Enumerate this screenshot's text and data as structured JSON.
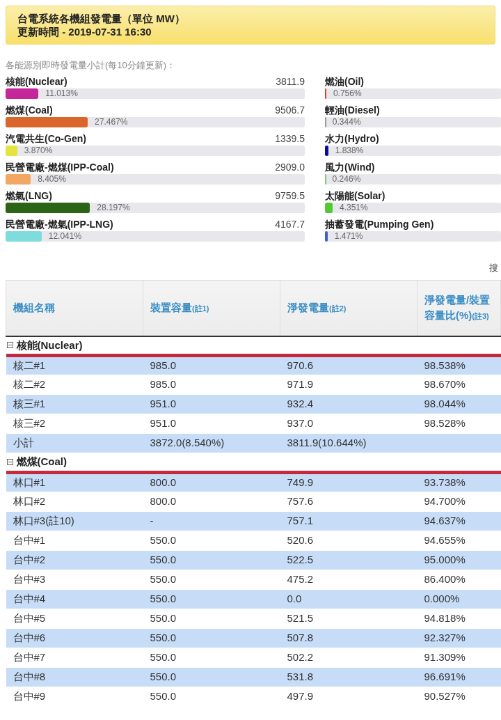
{
  "header": {
    "title": "台電系統各機組發電量（單位 MW）",
    "updated": "更新時間 - 2019-07-31 16:30"
  },
  "summary": {
    "caption": "各能源別即時發電量小計(每10分鐘更新)：",
    "left": [
      {
        "name": "核能(Nuclear)",
        "value": "3811.9",
        "percent": "11.013%",
        "level": 0.11013,
        "color": "#c4279a"
      },
      {
        "name": "燃煤(Coal)",
        "value": "9506.7",
        "percent": "27.467%",
        "level": 0.27467,
        "color": "#d9662b"
      },
      {
        "name": "汽電共生(Co-Gen)",
        "value": "1339.5",
        "percent": "3.870%",
        "level": 0.0387,
        "color": "#e6e340"
      },
      {
        "name": "民營電廠-燃煤(IPP-Coal)",
        "value": "2909.0",
        "percent": "8.405%",
        "level": 0.08405,
        "color": "#f2a863"
      },
      {
        "name": "燃氣(LNG)",
        "value": "9759.5",
        "percent": "28.197%",
        "level": 0.28197,
        "color": "#2a6414"
      },
      {
        "name": "民營電廠-燃氣(IPP-LNG)",
        "value": "4167.7",
        "percent": "12.041%",
        "level": 0.12041,
        "color": "#7fdcdc"
      }
    ],
    "right": [
      {
        "name": "燃油(Oil)",
        "percent": "0.756%",
        "level": 0.00756,
        "color": "#e0442c"
      },
      {
        "name": "輕油(Diesel)",
        "percent": "0.344%",
        "level": 0.00344,
        "color": "#9a9a9a"
      },
      {
        "name": "水力(Hydro)",
        "percent": "1.838%",
        "level": 0.01838,
        "color": "#0a0aa0"
      },
      {
        "name": "風力(Wind)",
        "percent": "0.246%",
        "level": 0.00246,
        "color": "#7fc77f"
      },
      {
        "name": "太陽能(Solar)",
        "percent": "4.351%",
        "level": 0.04351,
        "color": "#52c934"
      },
      {
        "name": "抽蓄發電(Pumping Gen)",
        "percent": "1.471%",
        "level": 0.01471,
        "color": "#3d63c9"
      }
    ]
  },
  "search_label": "搜",
  "table": {
    "columns": [
      {
        "label": "機組名稱"
      },
      {
        "label": "裝置容量",
        "note": "(註1)"
      },
      {
        "label": "淨發電量",
        "note": "(註2)"
      },
      {
        "label": "淨發電量/裝置容量比(%)",
        "note": "(註3)"
      }
    ],
    "groups": [
      {
        "name": "核能(Nuclear)",
        "expanded": true,
        "rows": [
          {
            "kind": "unit",
            "cells": [
              "核二#1",
              "985.0",
              "970.6",
              "98.538%"
            ]
          },
          {
            "kind": "unit",
            "cells": [
              "核二#2",
              "985.0",
              "971.9",
              "98.670%"
            ]
          },
          {
            "kind": "unit",
            "cells": [
              "核三#1",
              "951.0",
              "932.4",
              "98.044%"
            ]
          },
          {
            "kind": "unit",
            "cells": [
              "核三#2",
              "951.0",
              "937.0",
              "98.528%"
            ]
          },
          {
            "kind": "subtotal",
            "cells": [
              "小計",
              "3872.0(8.540%)",
              "3811.9(10.644%)"
            ]
          }
        ]
      },
      {
        "name": "燃煤(Coal)",
        "expanded": true,
        "rows": [
          {
            "kind": "unit",
            "cells": [
              "林口#1",
              "800.0",
              "749.9",
              "93.738%"
            ]
          },
          {
            "kind": "unit",
            "cells": [
              "林口#2",
              "800.0",
              "757.6",
              "94.700%"
            ]
          },
          {
            "kind": "unit",
            "cells": [
              "林口#3(註10)",
              "-",
              "757.1",
              "94.637%"
            ]
          },
          {
            "kind": "unit",
            "cells": [
              "台中#1",
              "550.0",
              "520.6",
              "94.655%"
            ]
          },
          {
            "kind": "unit",
            "cells": [
              "台中#2",
              "550.0",
              "522.5",
              "95.000%"
            ]
          },
          {
            "kind": "unit",
            "cells": [
              "台中#3",
              "550.0",
              "475.2",
              "86.400%"
            ]
          },
          {
            "kind": "unit",
            "cells": [
              "台中#4",
              "550.0",
              "0.0",
              "0.000%"
            ]
          },
          {
            "kind": "unit",
            "cells": [
              "台中#5",
              "550.0",
              "521.5",
              "94.818%"
            ]
          },
          {
            "kind": "unit",
            "cells": [
              "台中#6",
              "550.0",
              "507.8",
              "92.327%"
            ]
          },
          {
            "kind": "unit",
            "cells": [
              "台中#7",
              "550.0",
              "502.2",
              "91.309%"
            ]
          },
          {
            "kind": "unit",
            "cells": [
              "台中#8",
              "550.0",
              "531.8",
              "96.691%"
            ]
          },
          {
            "kind": "unit",
            "cells": [
              "台中#9",
              "550.0",
              "497.9",
              "90.527%"
            ]
          }
        ]
      }
    ]
  }
}
